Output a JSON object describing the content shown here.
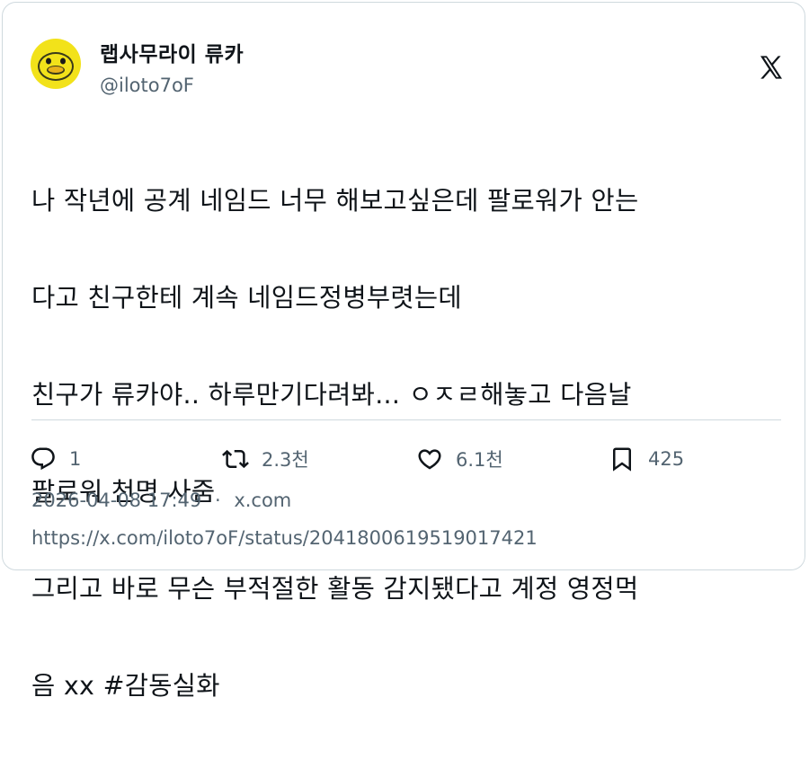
{
  "author": {
    "display_name": "랩사무라이 류카",
    "handle": "@iloto7oF",
    "avatar": "yellow-duck-avatar"
  },
  "platform_icon": "x-logo-icon",
  "tweet": {
    "lines": [
      "나 작년에 공계 네임드 너무 해보고싶은데 팔로워가 안는",
      "다고 친구한테 계속 네임드정병부렷는데",
      "친구가 류카야.. 하루만기다려봐... ㅇㅈㄹ해놓고 다음날",
      "팔로워 천명 사줌",
      "그리고 바로 무슨 부적절한 활동 감지됐다고 계정 영정먹",
      "음 xx #감동실화"
    ]
  },
  "actions": {
    "replies": "1",
    "retweets": "2.3천",
    "likes": "6.1천",
    "bookmarks": "425"
  },
  "timestamp": "2026-04-08 17:49",
  "separator": "·",
  "source": "x.com",
  "url": "https://x.com/iloto7oF/status/2041800619519017421",
  "colors": {
    "text": "#0f1419",
    "secondary": "#536471",
    "border": "#cfd9de",
    "avatar_yellow": "#f2e21a"
  }
}
